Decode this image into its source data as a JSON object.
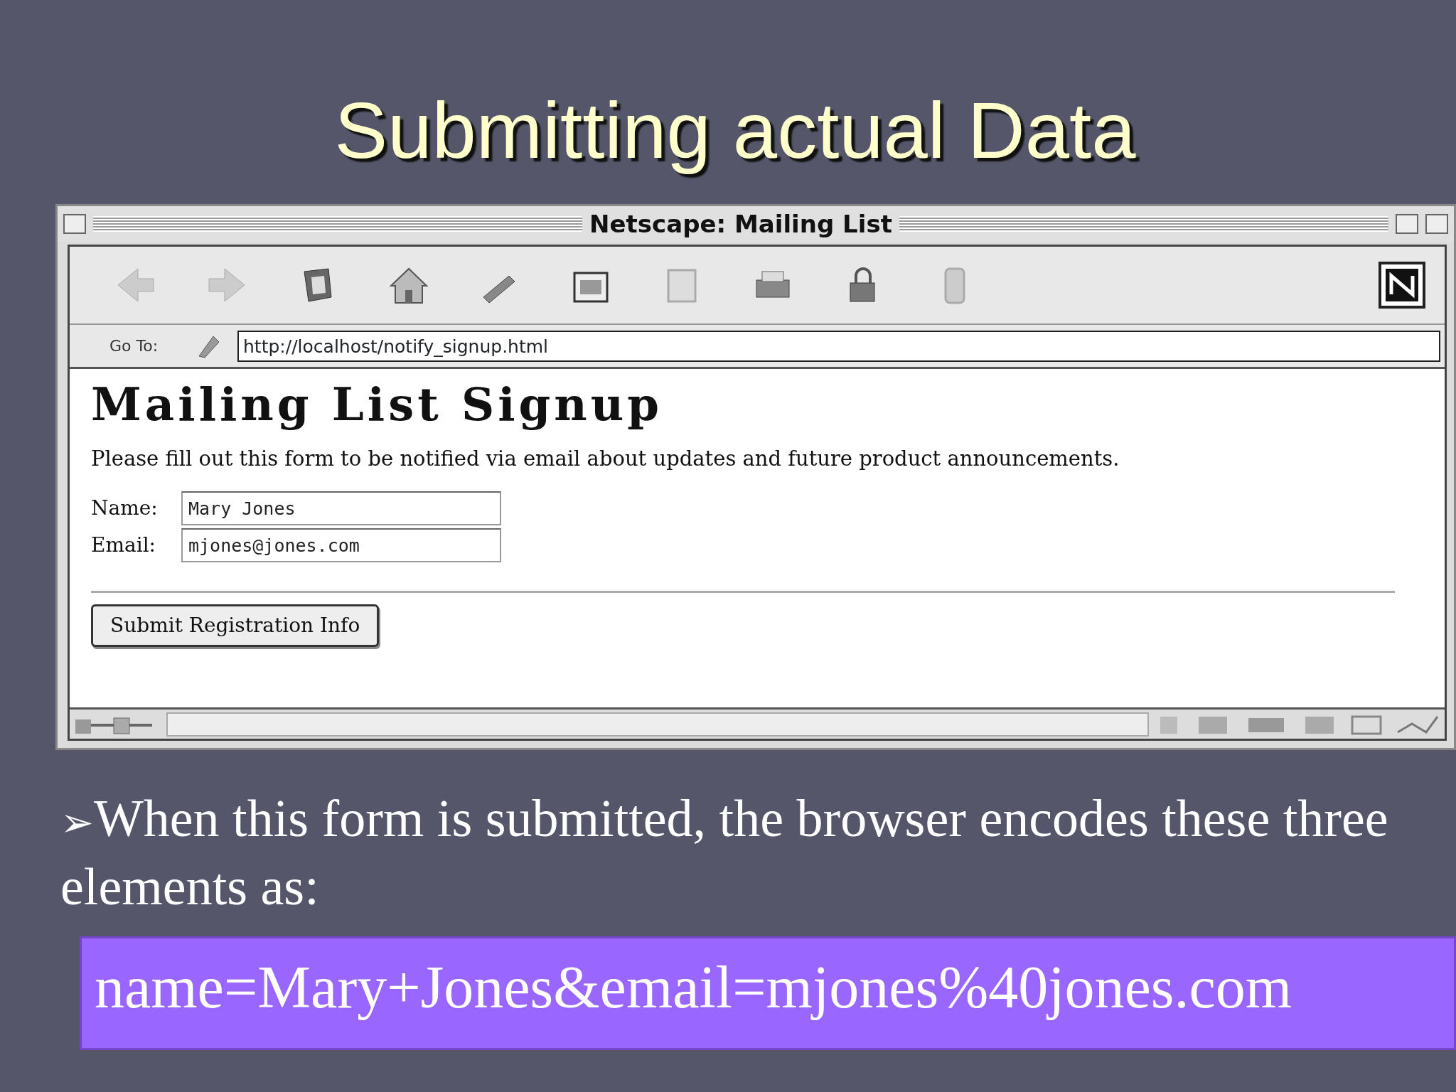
{
  "slide": {
    "title": "Submitting actual Data"
  },
  "browser": {
    "title": "Netscape: Mailing List",
    "location_label": "Go To:",
    "url": "http://localhost/notify_signup.html",
    "page": {
      "heading": "Mailing List Signup",
      "intro": "Please fill out this form to be notified via email about updates and future product announcements.",
      "fields": [
        {
          "label": "Name:",
          "value": "Mary Jones"
        },
        {
          "label": "Email:",
          "value": "mjones@jones.com"
        }
      ],
      "submit": "Submit Registration Info"
    }
  },
  "bullet": {
    "marker": "➢",
    "text": "When this form is submitted, the browser encodes these three elements as:"
  },
  "encoded": "name=Mary+Jones&email=mjones%40jones.com"
}
